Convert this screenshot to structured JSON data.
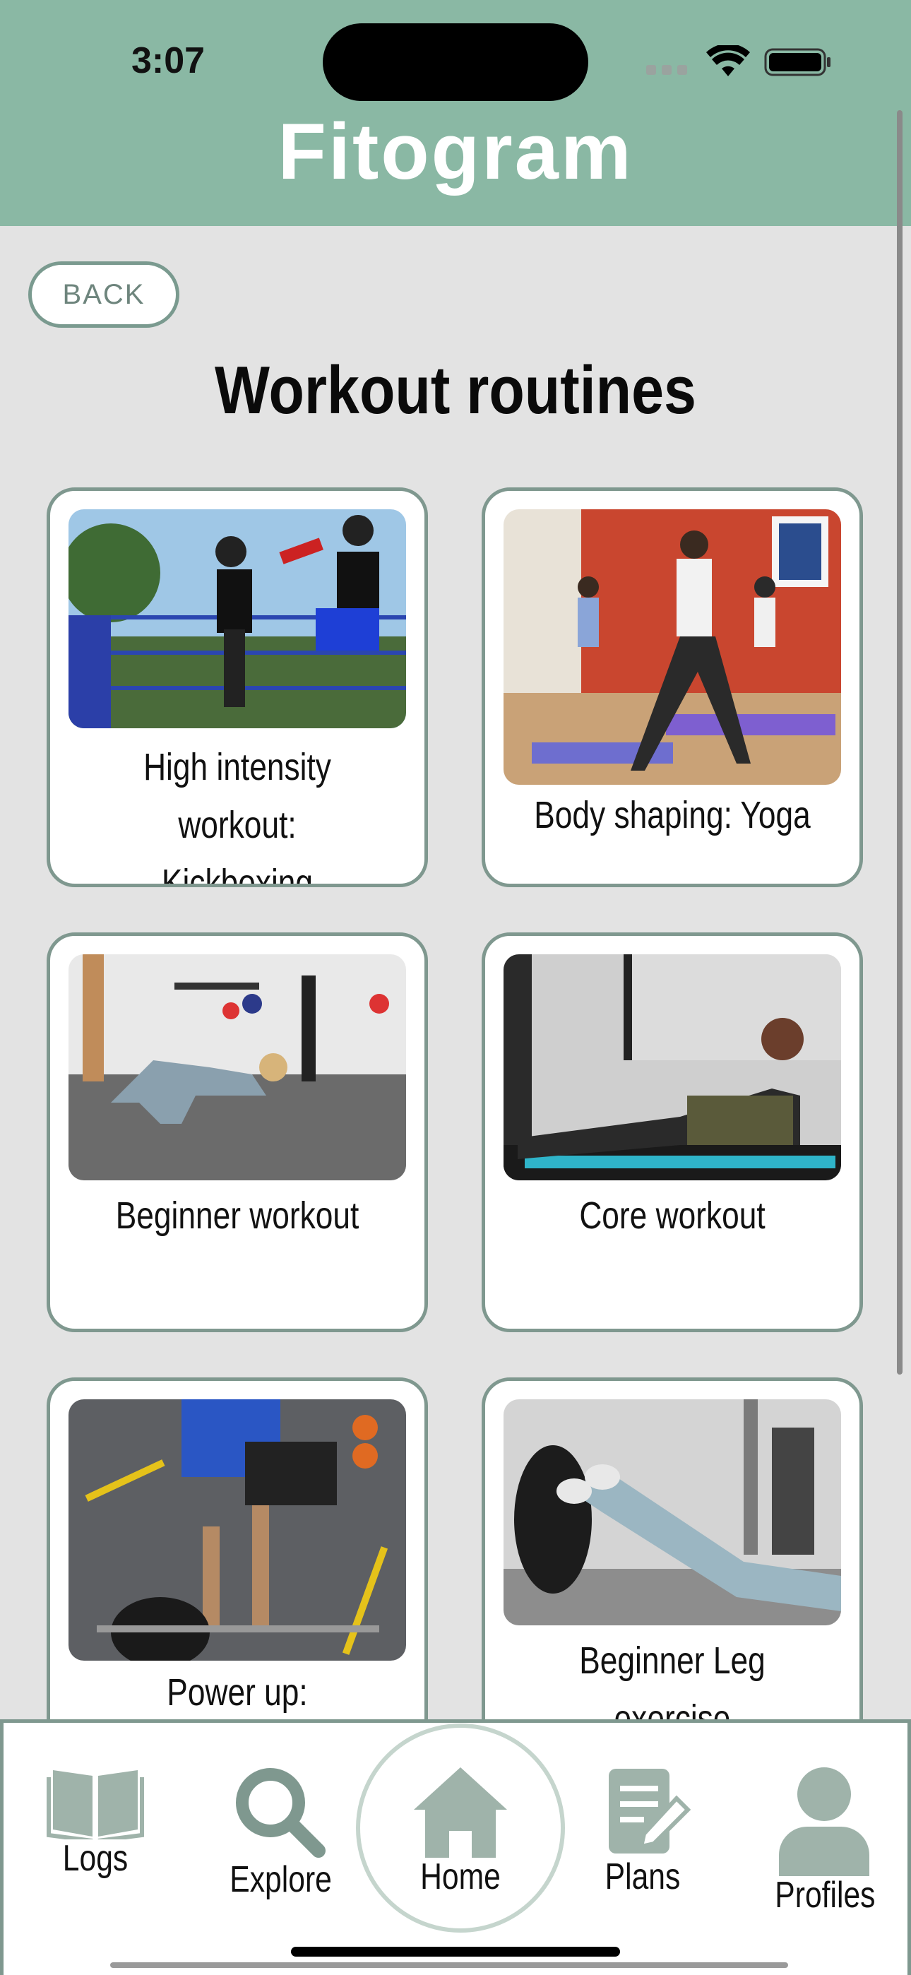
{
  "status_bar": {
    "time": "3:07"
  },
  "header": {
    "app_title": "Fitogram"
  },
  "back_button": {
    "label": "BACK"
  },
  "page": {
    "title": "Workout routines"
  },
  "cards": [
    {
      "line1": "High intensity workout:",
      "line2": "Kickboxing"
    },
    {
      "line1": "Body shaping: Yoga",
      "line2": ""
    },
    {
      "line1": "Beginner workout",
      "line2": ""
    },
    {
      "line1": "Core workout",
      "line2": ""
    },
    {
      "line1": "Power up:",
      "line2": ""
    },
    {
      "line1": "Beginner Leg exercise",
      "line2": ""
    }
  ],
  "tabbar": {
    "items": [
      {
        "label": "Logs",
        "icon": "book-icon"
      },
      {
        "label": "Explore",
        "icon": "search-icon"
      },
      {
        "label": "Home",
        "icon": "home-icon"
      },
      {
        "label": "Plans",
        "icon": "document-edit-icon"
      },
      {
        "label": "Profiles",
        "icon": "person-icon"
      }
    ]
  },
  "colors": {
    "header": "#8ab8a4",
    "accent_border": "#7f988f",
    "icon_gray": "#9fb3aa",
    "background": "#e3e3e3"
  }
}
